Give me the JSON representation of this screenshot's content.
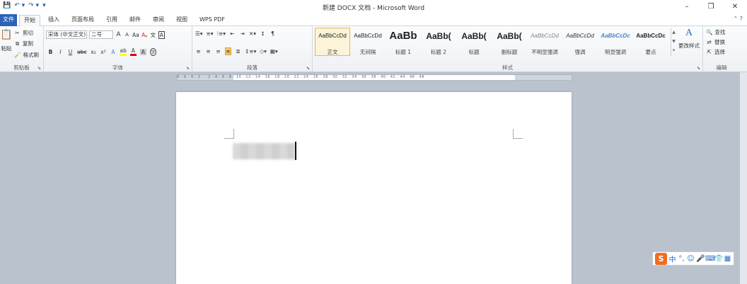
{
  "window": {
    "title": "新建 DOCX 文档 - Microsoft Word",
    "minimize": "–",
    "restore": "❐",
    "close": "✕"
  },
  "qat": {
    "save": "💾",
    "undo": "↶ ▾",
    "redo": "↷ ▾",
    "customize": "▾"
  },
  "tabs": {
    "file": "文件",
    "items": [
      "开始",
      "插入",
      "页面布局",
      "引用",
      "邮件",
      "审阅",
      "视图",
      "WPS PDF"
    ],
    "active": "开始",
    "right_icons": "⌃ ?"
  },
  "clipboard": {
    "paste": "粘贴",
    "cut": "剪切",
    "copy": "复制",
    "format_painter": "格式刷",
    "label": "剪贴板"
  },
  "font": {
    "family": "宋体 (中文正文)",
    "size": "二号",
    "grow": "A",
    "shrink": "A",
    "case": "Aa",
    "clear": "Aᵩ",
    "phonetic": "文",
    "border": "A",
    "bold": "B",
    "italic": "I",
    "underline": "U",
    "strike": "abc",
    "subscript": "x₂",
    "superscript": "x²",
    "effects": "A",
    "highlight": "ab",
    "color": "A",
    "shading": "A",
    "enclose": "字",
    "label": "字体"
  },
  "paragraph": {
    "label": "段落"
  },
  "styles": {
    "label": "样式",
    "items": [
      {
        "sample": "AaBbCcDd",
        "name": "正文",
        "size": 8,
        "weight": "normal",
        "color": "#222"
      },
      {
        "sample": "AaBbCcDd",
        "name": "无间隔",
        "size": 8,
        "weight": "normal",
        "color": "#222"
      },
      {
        "sample": "AaBb",
        "name": "标题 1",
        "size": 15,
        "weight": "bold",
        "color": "#222"
      },
      {
        "sample": "AaBb(",
        "name": "标题 2",
        "size": 12,
        "weight": "bold",
        "color": "#222"
      },
      {
        "sample": "AaBb(",
        "name": "标题",
        "size": 12,
        "weight": "bold",
        "color": "#222"
      },
      {
        "sample": "AaBb(",
        "name": "副标题",
        "size": 12,
        "weight": "bold",
        "color": "#222"
      },
      {
        "sample": "AaBbCcDd",
        "name": "不明显强调",
        "size": 8,
        "weight": "normal",
        "color": "#888"
      },
      {
        "sample": "AaBbCcDd",
        "name": "强调",
        "size": 8,
        "weight": "normal",
        "color": "#333"
      },
      {
        "sample": "AaBbCcDc",
        "name": "明显强调",
        "size": 8,
        "weight": "bold",
        "color": "#4f81bd"
      },
      {
        "sample": "AaBbCcDc",
        "name": "要点",
        "size": 8,
        "weight": "bold",
        "color": "#222"
      }
    ],
    "change": "更改样式"
  },
  "editing": {
    "find": "查找",
    "replace": "替换",
    "select": "选择",
    "label": "编辑"
  },
  "ruler": {
    "ticks": "8 · 6 · 4 · 2 · · 2 · 4 · 6 · 8 · 10 · 12 · 14 · 16 · 18 · 20 · 22 · 24 · 26 · 28 · 30 · 32 · 34 · 36 · 38 · 40 · 42 · 44 · 46 · 48"
  },
  "ime": {
    "logo": "S",
    "mode": "中",
    "punct": "°,",
    "emoji": "☺",
    "voice": "🎤",
    "keyboard": "⌨",
    "skin": "👕",
    "tools": "▦"
  }
}
